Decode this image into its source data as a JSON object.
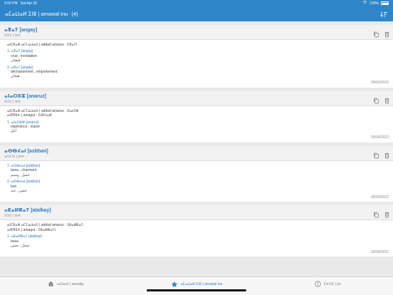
{
  "status": {
    "time": "5:50 PM",
    "date": "Sat Apr 30",
    "battery": "100%"
  },
  "navbar": {
    "title": "ⴰⵎⴰⵡⴰⵍ ⵉⵏⵓ | amawal inu",
    "count": "(4)"
  },
  "entries": [
    {
      "word": "ⴰⴳⴰⵢ [angay]",
      "pos": "ⵉⵙⵎ | ism",
      "lines": [
        {
          "text": "ⴰⵏⵎⴳⴰⵍ ⴰⵎⵢⴰⵡⴰⵙ | addad amaruz : ⵉⴳⴰⵢⵏ",
          "style": "row"
        }
      ],
      "senses": [
        {
          "head": "1. ⴰⴳⴰⵢ [angay]",
          "texts": [
            "crue , inondation",
            "فيضان"
          ]
        },
        {
          "head": "2. ⴰⴳⴰⵢ [angay]",
          "texts": [
            "déchaînement , emportement",
            "هيجان"
          ]
        }
      ],
      "date": "30/04/2022"
    },
    {
      "word": "ⴰⵏⴰⵔⵓⵣ [anaruz]",
      "pos": "ⵉⵙⵎ | ism",
      "lines": [
        {
          "text": "ⴰⵏⵎⴳⴰⵍ ⴰⵎⵢⴰⵡⴰⵙ | addad amaruz : ⵉⵏⴰⵔⵣ",
          "style": "row"
        },
        {
          "text": "ⴰⵏⴳⴳⵓⵜ | amagut : ⵉⵏⵓⵔⴰⵣ",
          "style": "row"
        }
      ],
      "senses": [
        {
          "head": "1. ⴰⵏⴰⵔⵓⵣ [anaruz]",
          "texts": [
            "espérance , espoir",
            "أمل"
          ]
        }
      ],
      "date": "30/04/2022"
    },
    {
      "word": "ⴰⵙⴱⵃⴰⵏ [asbḥan]",
      "pos": "ⴰⵔⵎⵙ | ahri",
      "lines": [],
      "senses": [
        {
          "head": "1. ⴰⵙⴱⵃⴰⵏ [asbḥan]",
          "texts": [
            "beau , charmant",
            "جميل , وسيم"
          ]
        },
        {
          "head": "2. ⴰⵙⴱⵃⴰⵏ [asbḥan]",
          "texts": [
            "bon",
            "حسن , جيد"
          ]
        }
      ],
      "date": "30/04/2022"
    },
    {
      "word": "ⴰⵟⴰⵍⴽⴰⵢ [atalkay]",
      "pos": "ⵉⵙⵎ | ism",
      "lines": [
        {
          "text": "ⴰⵏⵎⴳⴰⵍ ⴰⵎⵢⴰⵡⴰⵙ | addad amaruz : ⵉⵟⴰⵍⴽⴰⵢ",
          "style": "row"
        },
        {
          "text": "ⴰⵏⴳⴳⵓⵜ | amagut : ⵉⵟⴰⵍⴽⴰⵢⵏ",
          "style": "row"
        }
      ],
      "senses": [
        {
          "head": "1. ⴰⵟⴰⵍⴽⴰⵢ [atalkay]",
          "texts": [
            "beau",
            "جميل , حسن"
          ]
        }
      ],
      "date": "30/04/2022"
    }
  ],
  "tabs": [
    {
      "label": "ⴰⵙⵏⴰⵙ | asnubg",
      "icon": "home-icon",
      "active": false
    },
    {
      "label": "ⴰⵎⴰⵡⴰⵍ ⵉⵏⵓ | amawal inu",
      "icon": "star-icon",
      "active": true
    },
    {
      "label": "ⵉⵖⵔⵉ | yir",
      "icon": "info-icon",
      "active": false
    }
  ],
  "colors": {
    "accent": "#2e86c9",
    "link": "#2e7ac2"
  }
}
